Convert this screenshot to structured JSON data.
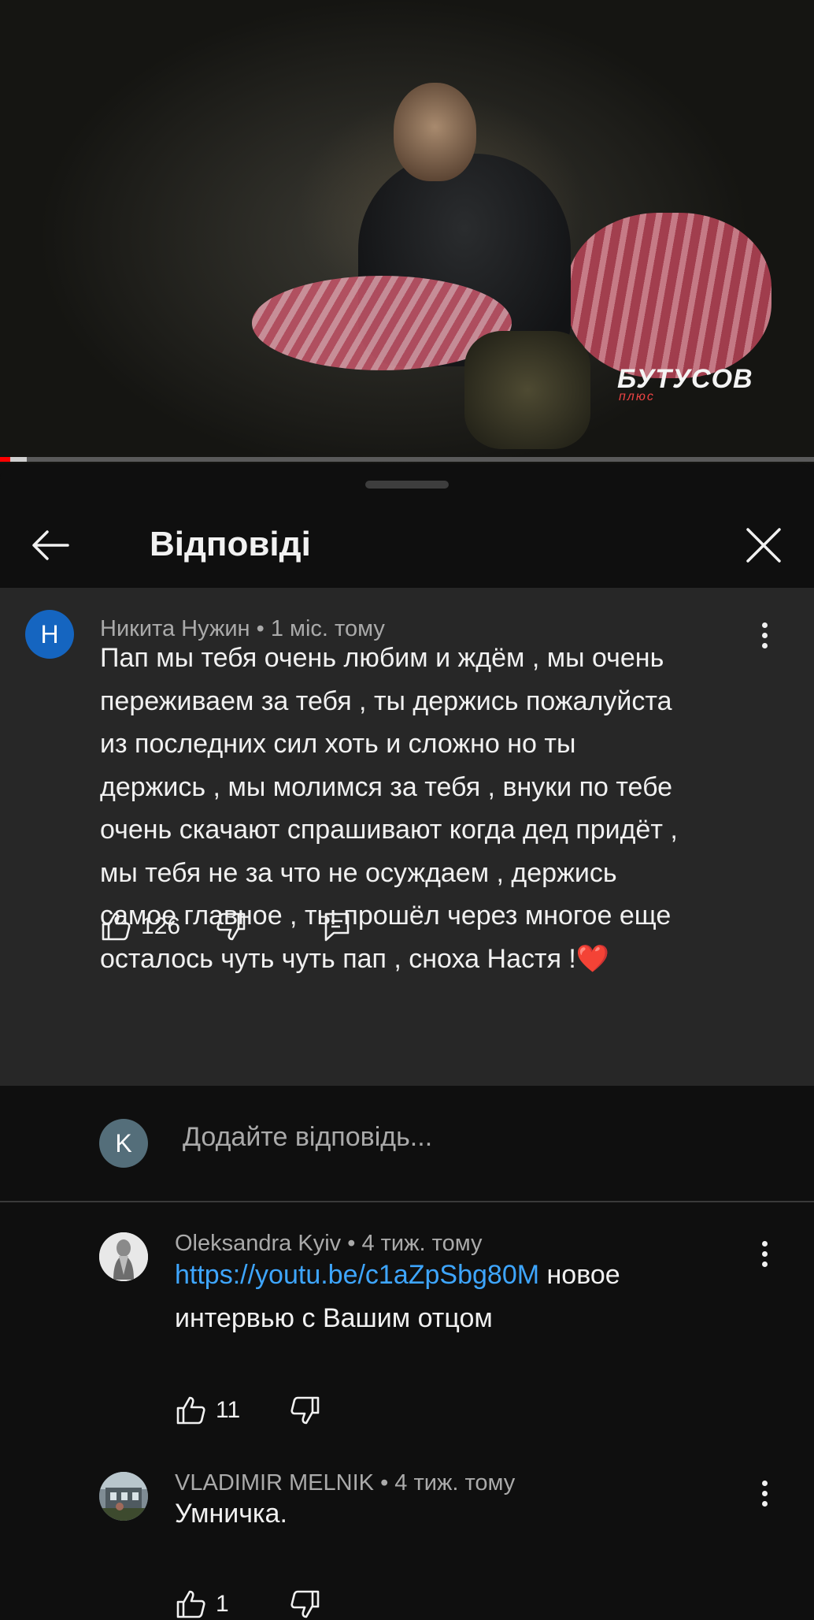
{
  "video": {
    "watermark": "БУТУСОВ",
    "watermark_sub": "плюс",
    "progress": {
      "played": 0.013,
      "buffered": 0.033
    }
  },
  "header": {
    "title": "Відповіді"
  },
  "parent_comment": {
    "avatar_letter": "Н",
    "author": "Никита Нужин",
    "time": "1 міс. тому",
    "lines": [
      "Пап мы тебя очень любим и ждём , мы очень",
      "переживаем за тебя , ты держись пожалуйста",
      "из последних сил хоть и сложно но ты",
      "держись , мы молимся за тебя , внуки по тебе",
      "очень скачают спрашивают когда дед придёт ,",
      "мы тебя не за что не осуждаем , держись",
      "самое главное , ты прошёл через многое еще",
      "осталось чуть чуть пап , сноха Настя !❤️"
    ],
    "likes": "126"
  },
  "reply_box": {
    "avatar_letter": "K",
    "placeholder": "Додайте відповідь..."
  },
  "replies": [
    {
      "author": "Oleksandra Kyiv",
      "time": "4 тиж. тому",
      "link": "https://youtu.be/c1aZpSbg80M",
      "text_after_link": " новое",
      "line2": "интервью с Вашим отцом",
      "likes": "11"
    },
    {
      "author": "VLADIMIR MELNIK",
      "time": "4 тиж. тому",
      "text": "Умничка.",
      "likes": "1"
    }
  ],
  "colors": {
    "background": "#0f0f0f",
    "highlight": "#272727",
    "link": "#3ea6ff",
    "avatar_blue": "#1565c0",
    "avatar_grey": "#546e7a"
  }
}
